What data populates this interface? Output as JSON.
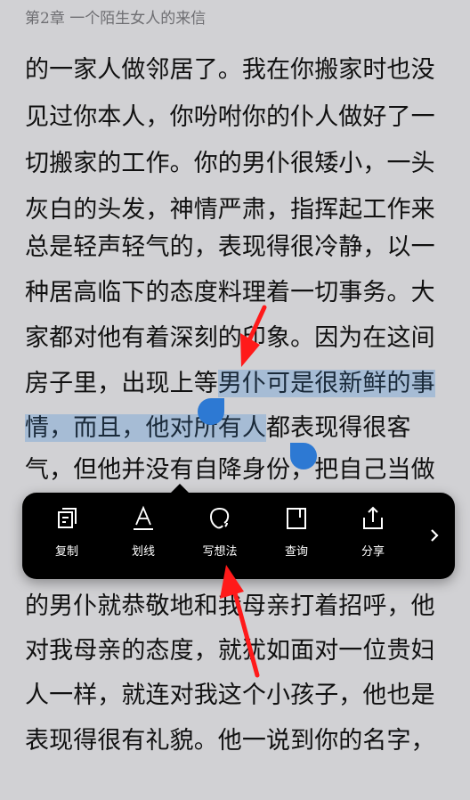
{
  "header": {
    "chapter_title": "第2章 一个陌生女人的来信"
  },
  "text_lines": [
    "的一家人做邻居了。我在你搬家时也没",
    "见过你本人，你吩咐你的仆人做好了一",
    "切搬家的工作。你的男仆很矮小，一头",
    "灰白的头发，神情严肃，指挥起工作来",
    "总是轻声轻气的，表现得很冷静，以一",
    "种居高临下的态度料理着一切事务。大",
    "家都对他有着深刻的印象。因为在这间"
  ],
  "selection_lines": {
    "line1_before": "房子里，出现上等",
    "line1_selected": "男仆可是很新鲜的事",
    "line2_selected": "情，而且，他对所有人",
    "line2_after": "都表现得很客"
  },
  "text_after_selection": "气，但他并没有自降身份，把自己当做",
  "text_lines_bottom": [
    "的男仆就恭敬地和我母亲打着招呼，他",
    "对我母亲的态度，就犹如面对一位贵妇",
    "人一样，就连对我这个小孩子，他也是",
    "表现得很有礼貌。他一说到你的名字，"
  ],
  "toolbar": {
    "items": [
      {
        "label": "复制",
        "icon": "copy-icon"
      },
      {
        "label": "划线",
        "icon": "underline-icon"
      },
      {
        "label": "写想法",
        "icon": "thought-icon"
      },
      {
        "label": "查询",
        "icon": "lookup-icon"
      },
      {
        "label": "分享",
        "icon": "share-icon"
      }
    ],
    "more_icon": "chevron-right-icon"
  },
  "colors": {
    "background": "#d1d1d4",
    "selection": "#a6bcd5",
    "handle": "#2d79d3",
    "toolbar": "#000000",
    "annotation_arrow": "#ff0000"
  }
}
